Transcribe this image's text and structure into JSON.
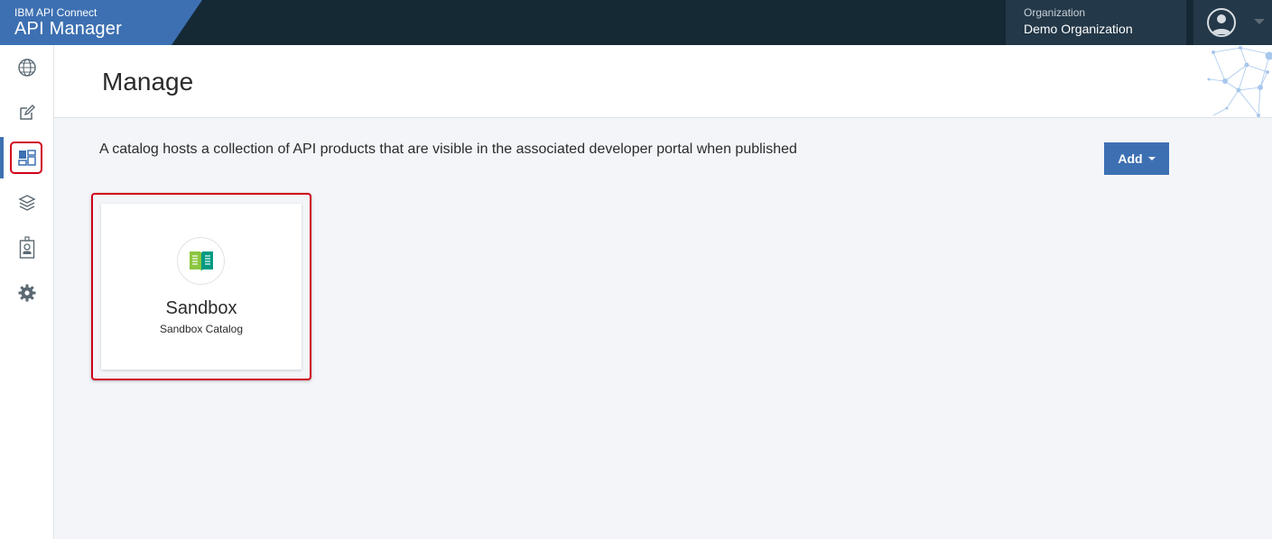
{
  "topbar": {
    "brand_sub": "IBM API Connect",
    "brand_title": "API Manager",
    "brand_color": "#3d70b2",
    "background_color": "#152935",
    "organization_label": "Organization",
    "organization_name": "Demo Organization",
    "user_icon": "user-avatar-icon"
  },
  "sidebar": {
    "items": [
      {
        "name": "home",
        "icon": "globe-icon"
      },
      {
        "name": "develop",
        "icon": "edit-icon"
      },
      {
        "name": "manage",
        "icon": "dashboard-icon",
        "active": true,
        "highlighted": true
      },
      {
        "name": "resources",
        "icon": "layers-icon"
      },
      {
        "name": "members",
        "icon": "badge-icon"
      },
      {
        "name": "settings",
        "icon": "gear-icon"
      }
    ]
  },
  "header": {
    "title": "Manage"
  },
  "main": {
    "description": "A catalog hosts a collection of API products that are visible in the associated developer portal when published",
    "add_label": "Add",
    "add_color": "#3d70b2"
  },
  "catalogs": [
    {
      "title": "Sandbox",
      "subtitle": "Sandbox Catalog",
      "icon": "book-icon",
      "highlighted": true
    }
  ]
}
